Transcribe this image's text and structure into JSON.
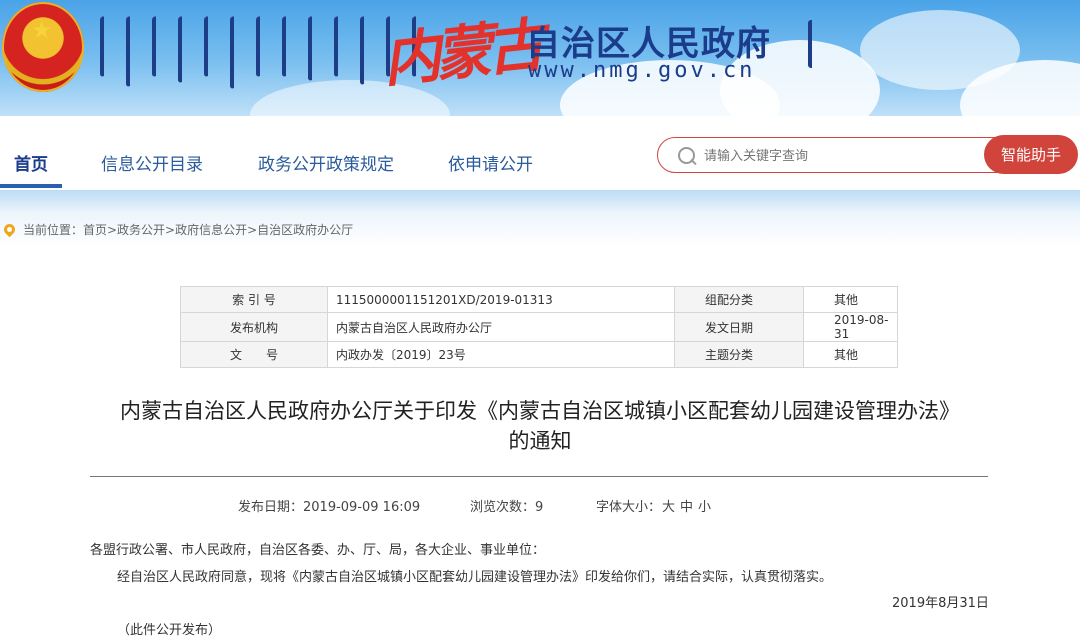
{
  "header": {
    "brand_cursive": "内蒙古",
    "brand_title": "自治区人民政府",
    "brand_url": "www.nmg.gov.cn"
  },
  "nav": {
    "items": [
      "首页",
      "信息公开目录",
      "政务公开政策规定",
      "依申请公开"
    ],
    "active_index": 0
  },
  "search": {
    "placeholder": "请输入关键字查询",
    "assistant_label": "智能助手"
  },
  "breadcrumb": "当前位置：首页>政务公开>政府信息公开>自治区政府办公厅",
  "meta_table": [
    {
      "k1": "索 引 号",
      "v1": "1115000001151201XD/2019-01313",
      "k2": "组配分类",
      "v2": "其他"
    },
    {
      "k1": "发布机构",
      "v1": "内蒙古自治区人民政府办公厅",
      "k2": "发文日期",
      "v2": "2019-08-31"
    },
    {
      "k1": "文　　号",
      "v1": "内政办发〔2019〕23号",
      "k2": "主题分类",
      "v2": "其他"
    }
  ],
  "doc": {
    "title_line1": "内蒙古自治区人民政府办公厅关于印发《内蒙古自治区城镇小区配套幼儿园建设管理办法》",
    "title_line2": "的通知",
    "publish_date": "发布日期：2019-09-09 16:09",
    "views": "浏览次数：9",
    "font_size_label": "字体大小：",
    "font_large": "大",
    "font_medium": "中",
    "font_small": "小",
    "salutation": "各盟行政公署、市人民政府，自治区各委、办、厅、局，各大企业、事业单位：",
    "paragraph": "经自治区人民政府同意，现将《内蒙古自治区城镇小区配套幼儿园建设管理办法》印发给你们，请结合实际，认真贯彻落实。",
    "sign_date": "2019年8月31日",
    "note": "（此件公开发布）"
  },
  "colors": {
    "accent_red": "#d0443c",
    "nav_blue": "#1b3c8a"
  }
}
